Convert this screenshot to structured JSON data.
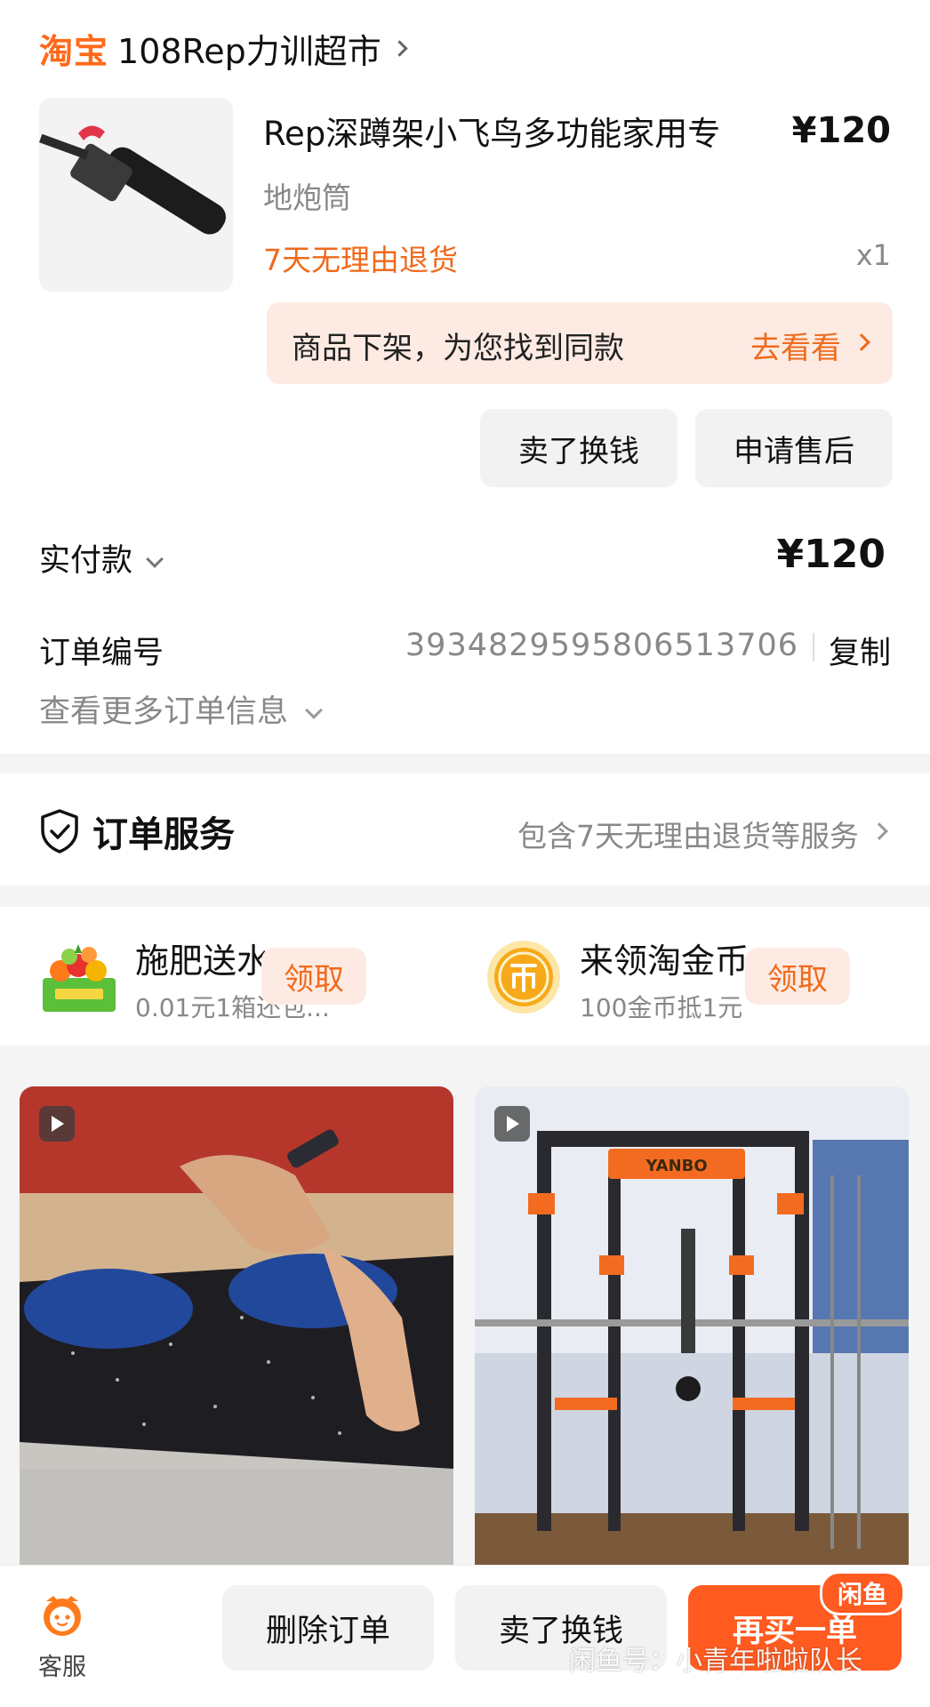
{
  "store": {
    "brand": "淘宝",
    "name": "108Rep力训超市"
  },
  "product": {
    "title": "Rep深蹲架小飞鸟多功能家用专",
    "sku": "地炮筒",
    "return_policy": "7天无理由退货",
    "price": "¥120",
    "quantity": "x1",
    "icon": "landmine-attachment-image"
  },
  "notice": {
    "text": "商品下架，为您找到同款",
    "link_label": "去看看"
  },
  "actions": {
    "sell": "卖了换钱",
    "after_sale": "申请售后"
  },
  "payment": {
    "label": "实付款",
    "amount": "¥120"
  },
  "order": {
    "number_label": "订单编号",
    "number": "3934829595806513706",
    "copy_label": "复制",
    "more_info": "查看更多订单信息"
  },
  "service": {
    "title": "订单服务",
    "description": "包含7天无理由退货等服务",
    "icon": "shield-check-icon"
  },
  "promos": [
    {
      "title": "施肥送水...",
      "subtitle": "0.01元1箱还包...",
      "button": "领取",
      "icon": "fruit-basket-icon"
    },
    {
      "title": "来领淘金币",
      "subtitle": "100金币抵1元",
      "button": "领取",
      "icon": "gold-coin-icon"
    }
  ],
  "feed": [
    {
      "kind": "video",
      "image": "rubber-floor-tiles-photo"
    },
    {
      "kind": "video",
      "image": "smith-machine-rack-photo",
      "brand_mark": "YANBO"
    }
  ],
  "bottom_bar": {
    "customer_service": "客服",
    "delete": "删除订单",
    "sell": "卖了换钱",
    "rebuy": "再买一单",
    "badge": "闲鱼",
    "watermark": "闲鱼号：小青年啦啦队长"
  },
  "colors": {
    "accent": "#ff6a1a",
    "accent_bg": "#fdebe3",
    "primary_button": "#ff5a1f"
  }
}
